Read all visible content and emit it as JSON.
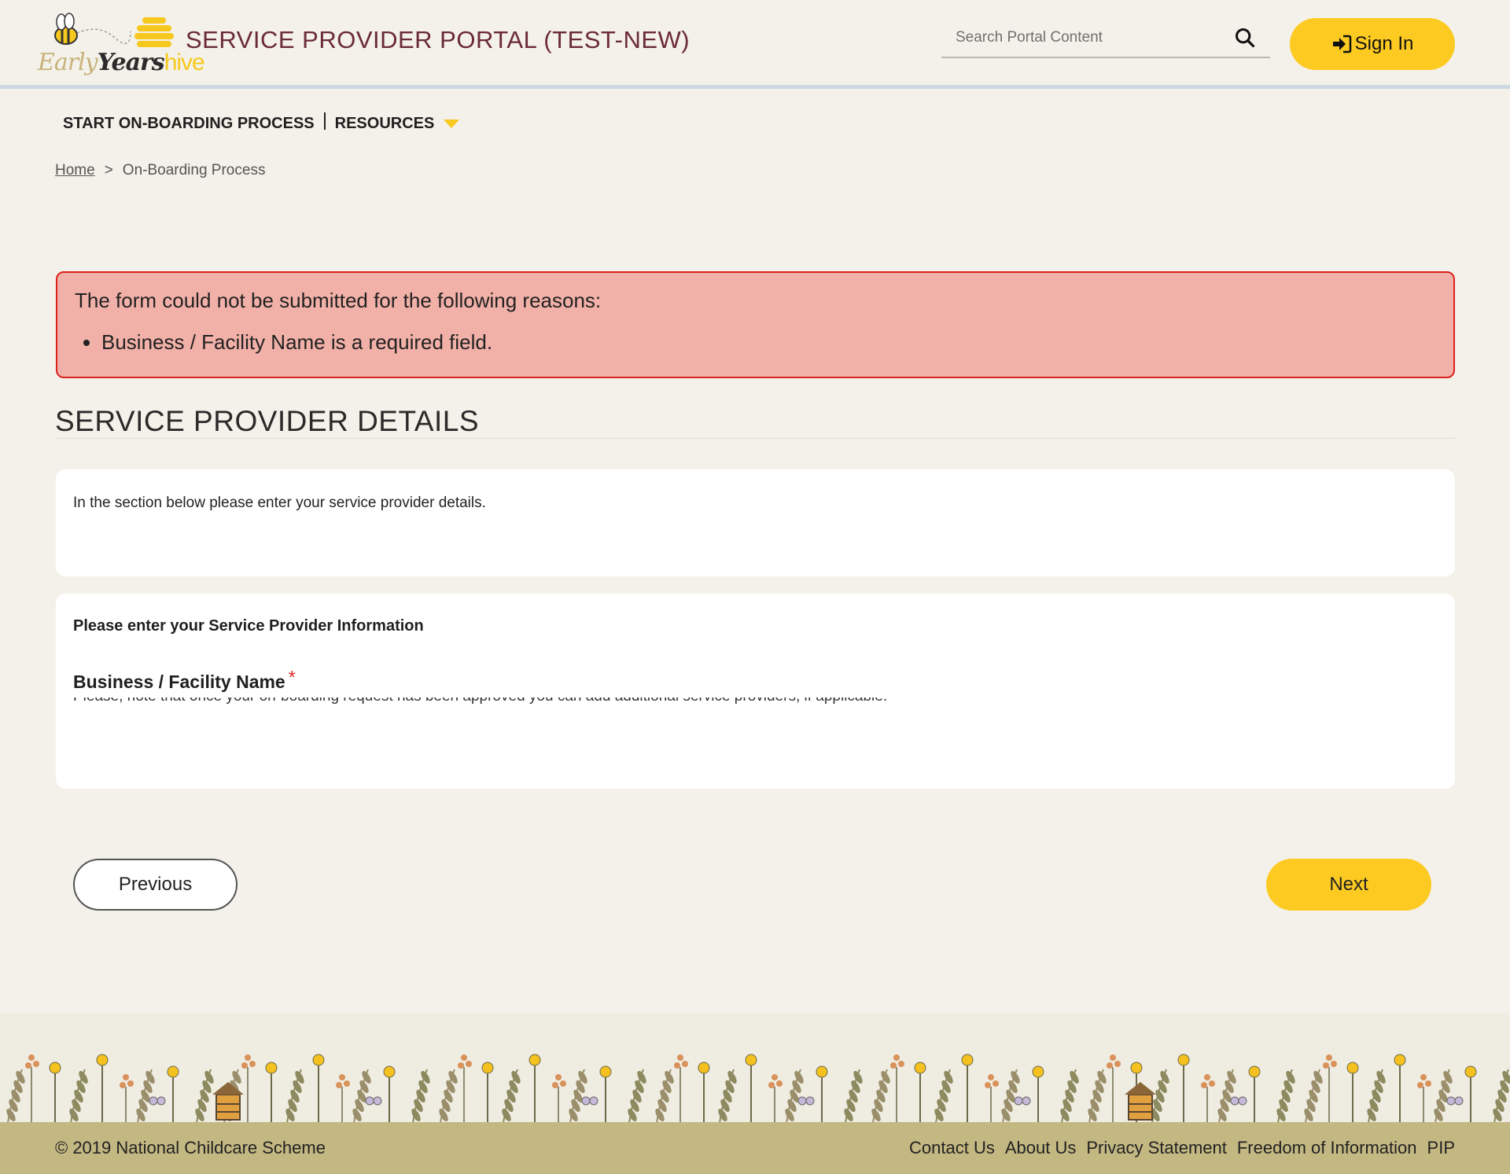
{
  "header": {
    "logo": {
      "early": "Early",
      "years": "Years",
      "hive": "hive"
    },
    "portal_title": "SERVICE PROVIDER PORTAL (TEST-NEW)",
    "search_placeholder": "Search Portal Content",
    "sign_in_label": "Sign In"
  },
  "nav": {
    "items": [
      {
        "label": "START ON-BOARDING PROCESS"
      },
      {
        "label": "RESOURCES"
      }
    ]
  },
  "breadcrumb": {
    "home": "Home",
    "separator": ">",
    "current": "On-Boarding Process"
  },
  "alert": {
    "title": "The form could not be submitted for the following reasons:",
    "errors": [
      "Business / Facility Name is a required field."
    ]
  },
  "section": {
    "title": "SERVICE PROVIDER DETAILS"
  },
  "intro_card": {
    "text": "In the section below please enter your service provider details."
  },
  "info_card": {
    "heading": "Please enter your Service Provider Information",
    "field_label": "Business / Facility Name",
    "required_mark": "*",
    "note": "Please, note that once your on-boarding request has been approved you can add additional service providers, if applicable."
  },
  "buttons": {
    "previous": "Previous",
    "next": "Next"
  },
  "footer": {
    "copyright": "© 2019 National Childcare Scheme",
    "links": [
      "Contact Us",
      "About Us",
      "Privacy Statement",
      "Freedom of Information",
      "PIP"
    ]
  },
  "colors": {
    "accent": "#fdca22",
    "title": "#6b2b36",
    "error_bg": "#f2b1a8",
    "error_border": "#d9231c",
    "footer_bg": "#c3b782"
  }
}
